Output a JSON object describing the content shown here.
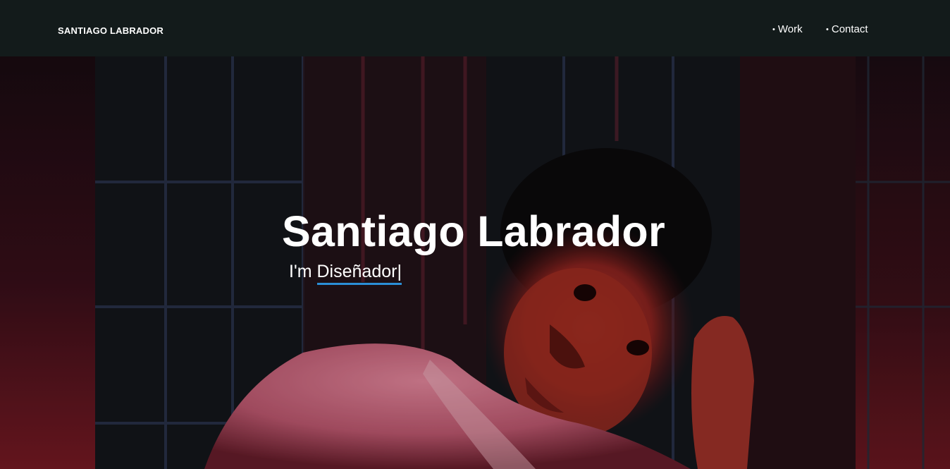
{
  "header": {
    "brand": "SANTIAGO LABRADOR",
    "nav": [
      {
        "label": "Work",
        "bullet": "•"
      },
      {
        "label": "Contact",
        "bullet": "•"
      }
    ]
  },
  "hero": {
    "title": "Santiago Labrador",
    "intro": "I'm",
    "typed_text": "Diseñador|"
  },
  "colors": {
    "navbar_bg": "#131b1b",
    "text": "#ffffff",
    "typed_underline": "#2a8ed6"
  }
}
